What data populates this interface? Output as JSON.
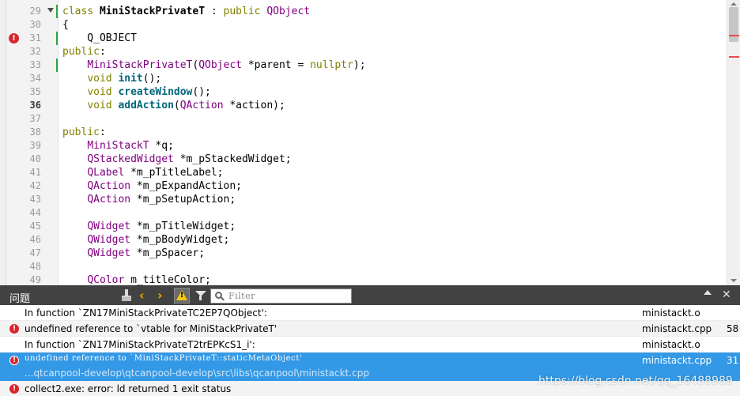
{
  "editor": {
    "lines": [
      {
        "num": "29",
        "bold": false,
        "error": false,
        "fold": true,
        "changed": true,
        "tokens": [
          {
            "t": "class ",
            "c": "kw"
          },
          {
            "t": "MiniStackPrivateT",
            "c": "bold"
          },
          {
            "t": " : ",
            "c": ""
          },
          {
            "t": "public ",
            "c": "kw"
          },
          {
            "t": "QObject",
            "c": "ty"
          }
        ]
      },
      {
        "num": "30",
        "bold": false,
        "error": false,
        "fold": false,
        "changed": false,
        "tokens": [
          {
            "t": "{",
            "c": ""
          }
        ]
      },
      {
        "num": "31",
        "bold": false,
        "error": true,
        "fold": false,
        "changed": true,
        "tokens": [
          {
            "t": "    Q_OBJECT",
            "c": ""
          }
        ]
      },
      {
        "num": "32",
        "bold": false,
        "error": false,
        "fold": false,
        "changed": false,
        "tokens": [
          {
            "t": "public",
            "c": "kw"
          },
          {
            "t": ":",
            "c": ""
          }
        ]
      },
      {
        "num": "33",
        "bold": false,
        "error": false,
        "fold": false,
        "changed": true,
        "tokens": [
          {
            "t": "    ",
            "c": ""
          },
          {
            "t": "MiniStackPrivateT",
            "c": "ty"
          },
          {
            "t": "(",
            "c": ""
          },
          {
            "t": "QObject",
            "c": "ty"
          },
          {
            "t": " *parent = ",
            "c": ""
          },
          {
            "t": "nullptr",
            "c": "kw"
          },
          {
            "t": ");",
            "c": ""
          }
        ]
      },
      {
        "num": "34",
        "bold": false,
        "error": false,
        "fold": false,
        "changed": false,
        "tokens": [
          {
            "t": "    ",
            "c": ""
          },
          {
            "t": "void ",
            "c": "kw"
          },
          {
            "t": "init",
            "c": "fn"
          },
          {
            "t": "();",
            "c": ""
          }
        ]
      },
      {
        "num": "35",
        "bold": false,
        "error": false,
        "fold": false,
        "changed": false,
        "tokens": [
          {
            "t": "    ",
            "c": ""
          },
          {
            "t": "void ",
            "c": "kw"
          },
          {
            "t": "createWindow",
            "c": "fn"
          },
          {
            "t": "();",
            "c": ""
          }
        ]
      },
      {
        "num": "36",
        "bold": true,
        "error": false,
        "fold": false,
        "changed": false,
        "tokens": [
          {
            "t": "    ",
            "c": ""
          },
          {
            "t": "void ",
            "c": "kw"
          },
          {
            "t": "addAction",
            "c": "fn"
          },
          {
            "t": "(",
            "c": ""
          },
          {
            "t": "QAction",
            "c": "ty"
          },
          {
            "t": " *action);",
            "c": ""
          }
        ]
      },
      {
        "num": "37",
        "bold": false,
        "error": false,
        "fold": false,
        "changed": false,
        "tokens": []
      },
      {
        "num": "38",
        "bold": false,
        "error": false,
        "fold": false,
        "changed": false,
        "tokens": [
          {
            "t": "public",
            "c": "kw"
          },
          {
            "t": ":",
            "c": ""
          }
        ]
      },
      {
        "num": "39",
        "bold": false,
        "error": false,
        "fold": false,
        "changed": false,
        "tokens": [
          {
            "t": "    ",
            "c": ""
          },
          {
            "t": "MiniStackT",
            "c": "ty"
          },
          {
            "t": " *q;",
            "c": ""
          }
        ]
      },
      {
        "num": "40",
        "bold": false,
        "error": false,
        "fold": false,
        "changed": false,
        "tokens": [
          {
            "t": "    ",
            "c": ""
          },
          {
            "t": "QStackedWidget",
            "c": "ty"
          },
          {
            "t": " *m_pStackedWidget;",
            "c": ""
          }
        ]
      },
      {
        "num": "41",
        "bold": false,
        "error": false,
        "fold": false,
        "changed": false,
        "tokens": [
          {
            "t": "    ",
            "c": ""
          },
          {
            "t": "QLabel",
            "c": "ty"
          },
          {
            "t": " *m_pTitleLabel;",
            "c": ""
          }
        ]
      },
      {
        "num": "42",
        "bold": false,
        "error": false,
        "fold": false,
        "changed": false,
        "tokens": [
          {
            "t": "    ",
            "c": ""
          },
          {
            "t": "QAction",
            "c": "ty"
          },
          {
            "t": " *m_pExpandAction;",
            "c": ""
          }
        ]
      },
      {
        "num": "43",
        "bold": false,
        "error": false,
        "fold": false,
        "changed": false,
        "tokens": [
          {
            "t": "    ",
            "c": ""
          },
          {
            "t": "QAction",
            "c": "ty"
          },
          {
            "t": " *m_pSetupAction;",
            "c": ""
          }
        ]
      },
      {
        "num": "44",
        "bold": false,
        "error": false,
        "fold": false,
        "changed": false,
        "tokens": []
      },
      {
        "num": "45",
        "bold": false,
        "error": false,
        "fold": false,
        "changed": false,
        "tokens": [
          {
            "t": "    ",
            "c": ""
          },
          {
            "t": "QWidget",
            "c": "ty"
          },
          {
            "t": " *m_pTitleWidget;",
            "c": ""
          }
        ]
      },
      {
        "num": "46",
        "bold": false,
        "error": false,
        "fold": false,
        "changed": false,
        "tokens": [
          {
            "t": "    ",
            "c": ""
          },
          {
            "t": "QWidget",
            "c": "ty"
          },
          {
            "t": " *m_pBodyWidget;",
            "c": ""
          }
        ]
      },
      {
        "num": "47",
        "bold": false,
        "error": false,
        "fold": false,
        "changed": false,
        "tokens": [
          {
            "t": "    ",
            "c": ""
          },
          {
            "t": "QWidget",
            "c": "ty"
          },
          {
            "t": " *m_pSpacer;",
            "c": ""
          }
        ]
      },
      {
        "num": "48",
        "bold": false,
        "error": false,
        "fold": false,
        "changed": false,
        "tokens": []
      },
      {
        "num": "49",
        "bold": false,
        "error": false,
        "fold": false,
        "changed": false,
        "tokens": [
          {
            "t": "    ",
            "c": ""
          },
          {
            "t": "QColor",
            "c": "ty"
          },
          {
            "t": " m_titleColor;",
            "c": ""
          }
        ]
      }
    ]
  },
  "issues_panel": {
    "title": "问题",
    "filter_placeholder": "Filter",
    "close_glyph": "✕",
    "prev_glyph": "‹",
    "next_glyph": "›",
    "warning_glyph": "!",
    "error_glyph": "!",
    "rows": [
      {
        "type": "info",
        "text": "In function `ZN17MiniStackPrivateTC2EP7QObject':",
        "file": "ministackt.o",
        "line": ""
      },
      {
        "type": "error",
        "text": "undefined reference to `vtable for MiniStackPrivateT'",
        "file": "ministackt.cpp",
        "line": "58"
      },
      {
        "type": "info",
        "text": "In function `ZN17MiniStackPrivateT2trEPKcS1_i':",
        "file": "ministackt.o",
        "line": ""
      },
      {
        "type": "error",
        "text": "undefined reference to `MiniStackPrivateT::staticMetaObject'",
        "file": "ministackt.cpp",
        "line": "31",
        "path": "...qtcanpool-develop\\qtcanpool-develop\\src\\libs\\qcanpool\\ministackt.cpp",
        "selected": true
      },
      {
        "type": "error",
        "text": "collect2.exe: error: ld returned 1 exit status",
        "file": "",
        "line": ""
      }
    ]
  },
  "watermark": "https://blog.csdn.net/qq_16488989",
  "colors": {
    "keyword": "#808000",
    "type": "#800080",
    "function": "#00677c",
    "error": "#d9262a",
    "selection": "#3399e6",
    "panel_toolbar": "#424242",
    "changed_marker": "#28a745"
  }
}
